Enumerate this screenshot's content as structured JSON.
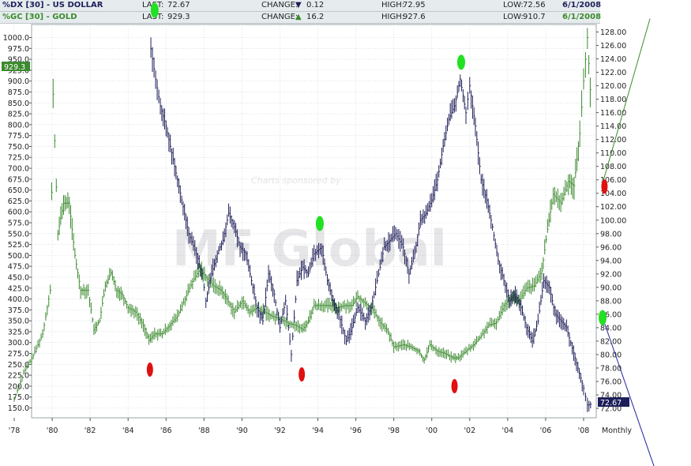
{
  "header": {
    "row1": {
      "symbol": "%DX [30] - US DOLLAR",
      "last_label": "LAST:",
      "last_value": "72.67",
      "change_label": "CHANGE:",
      "change_arrow": "▼",
      "change_value": "0.12",
      "high_label": "HIGH:",
      "high_value": "72.95",
      "low_label": "LOW:",
      "low_value": "72.56",
      "date": "6/1/2008"
    },
    "row2": {
      "symbol": "%GC [30] - GOLD",
      "last_label": "LAST:",
      "last_value": "929.3",
      "change_label": "CHANGE:",
      "change_arrow": "▲",
      "change_value": "16.2",
      "high_label": "HIGH:",
      "high_value": "927.6",
      "low_label": "LOW:",
      "low_value": "910.7",
      "date": "6/1/2008"
    }
  },
  "watermark": {
    "sponsor_text": "Charts sponsored by",
    "logo_text": "MF Global"
  },
  "colors": {
    "gold": "#3b8a2e",
    "dollar": "#1e1e5a",
    "green_marker": "#22e022",
    "red_marker": "#e01010",
    "header_bg": "#e8eef0",
    "grid": "#c8d0d8"
  },
  "chart_data": {
    "type": "line",
    "x_tick_labels": [
      "'78",
      "'80",
      "'82",
      "'84",
      "'86",
      "'88",
      "'90",
      "'92",
      "'94",
      "'96",
      "'98",
      "'00",
      "'02",
      "'04",
      "'06",
      "'08"
    ],
    "x_period_label": "Monthly",
    "left_axis_ticks": [
      "150.0",
      "175.0",
      "200.0",
      "225.0",
      "250.0",
      "275.0",
      "300.0",
      "325.0",
      "350.0",
      "375.0",
      "400.0",
      "425.0",
      "450.0",
      "475.0",
      "500.0",
      "525.0",
      "550.0",
      "575.0",
      "600.0",
      "625.0",
      "650.0",
      "675.0",
      "700.0",
      "725.0",
      "750.0",
      "775.0",
      "800.0",
      "825.0",
      "850.0",
      "875.0",
      "900.0",
      "925.0",
      "950.0",
      "975.0",
      "1000.0"
    ],
    "right_axis_ticks": [
      "72.00",
      "74.00",
      "76.00",
      "78.00",
      "80.00",
      "82.00",
      "84.00",
      "86.00",
      "88.00",
      "90.00",
      "92.00",
      "94.00",
      "96.00",
      "98.00",
      "100.00",
      "102.00",
      "104.00",
      "106.00",
      "108.00",
      "110.00",
      "112.00",
      "114.00",
      "116.00",
      "118.00",
      "120.00",
      "122.00",
      "124.00",
      "126.00",
      "128.00"
    ],
    "left_axis_range": [
      125,
      1020
    ],
    "right_axis_range": [
      70.9,
      129.2
    ],
    "x_range": [
      1977.8,
      2008.7
    ],
    "gold_last_label": "929.3",
    "dollar_last_label": "72.67",
    "series": [
      {
        "name": "%GC [30] - GOLD",
        "axis": "left",
        "points": [
          [
            1978.0,
            170
          ],
          [
            1978.5,
            230
          ],
          [
            1979.0,
            270
          ],
          [
            1979.5,
            320
          ],
          [
            1979.9,
            420
          ],
          [
            1980.05,
            870
          ],
          [
            1980.3,
            550
          ],
          [
            1980.6,
            620
          ],
          [
            1980.9,
            620
          ],
          [
            1981.2,
            500
          ],
          [
            1981.5,
            420
          ],
          [
            1981.9,
            420
          ],
          [
            1982.2,
            330
          ],
          [
            1982.5,
            350
          ],
          [
            1982.8,
            430
          ],
          [
            1983.1,
            460
          ],
          [
            1983.4,
            420
          ],
          [
            1983.7,
            410
          ],
          [
            1984.0,
            380
          ],
          [
            1984.4,
            370
          ],
          [
            1984.8,
            340
          ],
          [
            1985.1,
            305
          ],
          [
            1985.4,
            320
          ],
          [
            1985.8,
            320
          ],
          [
            1986.2,
            340
          ],
          [
            1986.6,
            360
          ],
          [
            1987.0,
            400
          ],
          [
            1987.4,
            440
          ],
          [
            1987.8,
            470
          ],
          [
            1988.1,
            450
          ],
          [
            1988.5,
            430
          ],
          [
            1988.9,
            420
          ],
          [
            1989.2,
            400
          ],
          [
            1989.6,
            370
          ],
          [
            1990.0,
            395
          ],
          [
            1990.4,
            370
          ],
          [
            1990.8,
            380
          ],
          [
            1991.2,
            370
          ],
          [
            1991.6,
            360
          ],
          [
            1992.0,
            355
          ],
          [
            1992.4,
            345
          ],
          [
            1992.8,
            340
          ],
          [
            1993.2,
            330
          ],
          [
            1993.5,
            350
          ],
          [
            1993.8,
            385
          ],
          [
            1994.2,
            385
          ],
          [
            1994.6,
            385
          ],
          [
            1995.0,
            380
          ],
          [
            1995.4,
            385
          ],
          [
            1995.8,
            385
          ],
          [
            1996.1,
            405
          ],
          [
            1996.5,
            390
          ],
          [
            1996.9,
            375
          ],
          [
            1997.3,
            345
          ],
          [
            1997.7,
            325
          ],
          [
            1998.0,
            290
          ],
          [
            1998.5,
            295
          ],
          [
            1998.9,
            290
          ],
          [
            1999.3,
            280
          ],
          [
            1999.6,
            260
          ],
          [
            1999.9,
            295
          ],
          [
            2000.3,
            280
          ],
          [
            2000.7,
            275
          ],
          [
            2001.1,
            265
          ],
          [
            2001.4,
            265
          ],
          [
            2001.8,
            280
          ],
          [
            2002.2,
            295
          ],
          [
            2002.6,
            315
          ],
          [
            2003.0,
            340
          ],
          [
            2003.4,
            345
          ],
          [
            2003.8,
            385
          ],
          [
            2004.2,
            405
          ],
          [
            2004.6,
            395
          ],
          [
            2005.0,
            425
          ],
          [
            2005.4,
            430
          ],
          [
            2005.8,
            465
          ],
          [
            2006.1,
            560
          ],
          [
            2006.4,
            640
          ],
          [
            2006.8,
            620
          ],
          [
            2007.2,
            670
          ],
          [
            2007.5,
            660
          ],
          [
            2007.8,
            780
          ],
          [
            2008.0,
            900
          ],
          [
            2008.2,
            1000
          ],
          [
            2008.35,
            880
          ],
          [
            2008.45,
            929.3
          ]
        ]
      },
      {
        "name": "%DX [30] - US DOLLAR",
        "axis": "right",
        "points": [
          [
            1985.2,
            125.5
          ],
          [
            1985.45,
            121
          ],
          [
            1985.7,
            117
          ],
          [
            1986.0,
            114
          ],
          [
            1986.3,
            110
          ],
          [
            1986.6,
            106
          ],
          [
            1986.9,
            102
          ],
          [
            1987.2,
            98
          ],
          [
            1987.6,
            95
          ],
          [
            1987.9,
            92
          ],
          [
            1988.1,
            88
          ],
          [
            1988.4,
            92
          ],
          [
            1988.7,
            95
          ],
          [
            1989.0,
            97
          ],
          [
            1989.3,
            101
          ],
          [
            1989.6,
            99
          ],
          [
            1989.9,
            96
          ],
          [
            1990.2,
            95
          ],
          [
            1990.5,
            91
          ],
          [
            1990.8,
            87
          ],
          [
            1991.1,
            85
          ],
          [
            1991.4,
            92
          ],
          [
            1991.7,
            89
          ],
          [
            1992.0,
            84
          ],
          [
            1992.3,
            88
          ],
          [
            1992.6,
            80
          ],
          [
            1992.9,
            91
          ],
          [
            1993.2,
            93
          ],
          [
            1993.5,
            92
          ],
          [
            1993.8,
            95
          ],
          [
            1994.2,
            96
          ],
          [
            1994.5,
            91
          ],
          [
            1994.8,
            88
          ],
          [
            1995.1,
            86
          ],
          [
            1995.5,
            82
          ],
          [
            1995.8,
            84
          ],
          [
            1996.1,
            87
          ],
          [
            1996.5,
            85
          ],
          [
            1996.8,
            87
          ],
          [
            1997.2,
            92
          ],
          [
            1997.5,
            96
          ],
          [
            1997.8,
            97
          ],
          [
            1998.1,
            98
          ],
          [
            1998.5,
            96
          ],
          [
            1998.8,
            92
          ],
          [
            1999.1,
            95
          ],
          [
            1999.4,
            100
          ],
          [
            1999.7,
            101
          ],
          [
            2000.0,
            103
          ],
          [
            2000.3,
            106
          ],
          [
            2000.6,
            111
          ],
          [
            2000.9,
            115
          ],
          [
            2001.2,
            117
          ],
          [
            2001.5,
            121
          ],
          [
            2001.8,
            116
          ],
          [
            2002.0,
            120
          ],
          [
            2002.3,
            114
          ],
          [
            2002.6,
            106
          ],
          [
            2002.9,
            103
          ],
          [
            2003.2,
            99
          ],
          [
            2003.5,
            94
          ],
          [
            2003.8,
            91
          ],
          [
            2004.1,
            88
          ],
          [
            2004.4,
            89
          ],
          [
            2004.7,
            87
          ],
          [
            2005.0,
            84
          ],
          [
            2005.3,
            82
          ],
          [
            2005.6,
            85
          ],
          [
            2005.9,
            91
          ],
          [
            2006.2,
            90
          ],
          [
            2006.5,
            86
          ],
          [
            2006.8,
            85
          ],
          [
            2007.1,
            84
          ],
          [
            2007.4,
            81
          ],
          [
            2007.7,
            78
          ],
          [
            2008.0,
            75
          ],
          [
            2008.2,
            72.5
          ],
          [
            2008.45,
            72.67
          ]
        ]
      }
    ],
    "markers": [
      {
        "color": "green",
        "year": 1985.4,
        "axis": "top"
      },
      {
        "color": "green",
        "year": 1994.1,
        "axis": "right",
        "value": 99.5
      },
      {
        "color": "green",
        "year": 2001.55,
        "axis": "right",
        "value": 123.5
      },
      {
        "color": "green",
        "year": 2009.0,
        "axis": "right",
        "value": 85.5
      },
      {
        "color": "red",
        "year": 1985.15,
        "axis": "left",
        "value": 238
      },
      {
        "color": "red",
        "year": 1993.15,
        "axis": "left",
        "value": 227
      },
      {
        "color": "red",
        "year": 2001.2,
        "axis": "left",
        "value": 200
      },
      {
        "color": "red",
        "year": 2009.1,
        "axis": "right",
        "value": 105
      }
    ],
    "trend_lines": [
      {
        "color": "#3b8a2e",
        "from": [
          2009.0,
          105.5
        ],
        "to": [
          2011.5,
          130
        ]
      },
      {
        "color": "#2020a0",
        "from": [
          2009.0,
          85.5
        ],
        "to": [
          2012.0,
          61
        ]
      }
    ],
    "grid": true
  }
}
